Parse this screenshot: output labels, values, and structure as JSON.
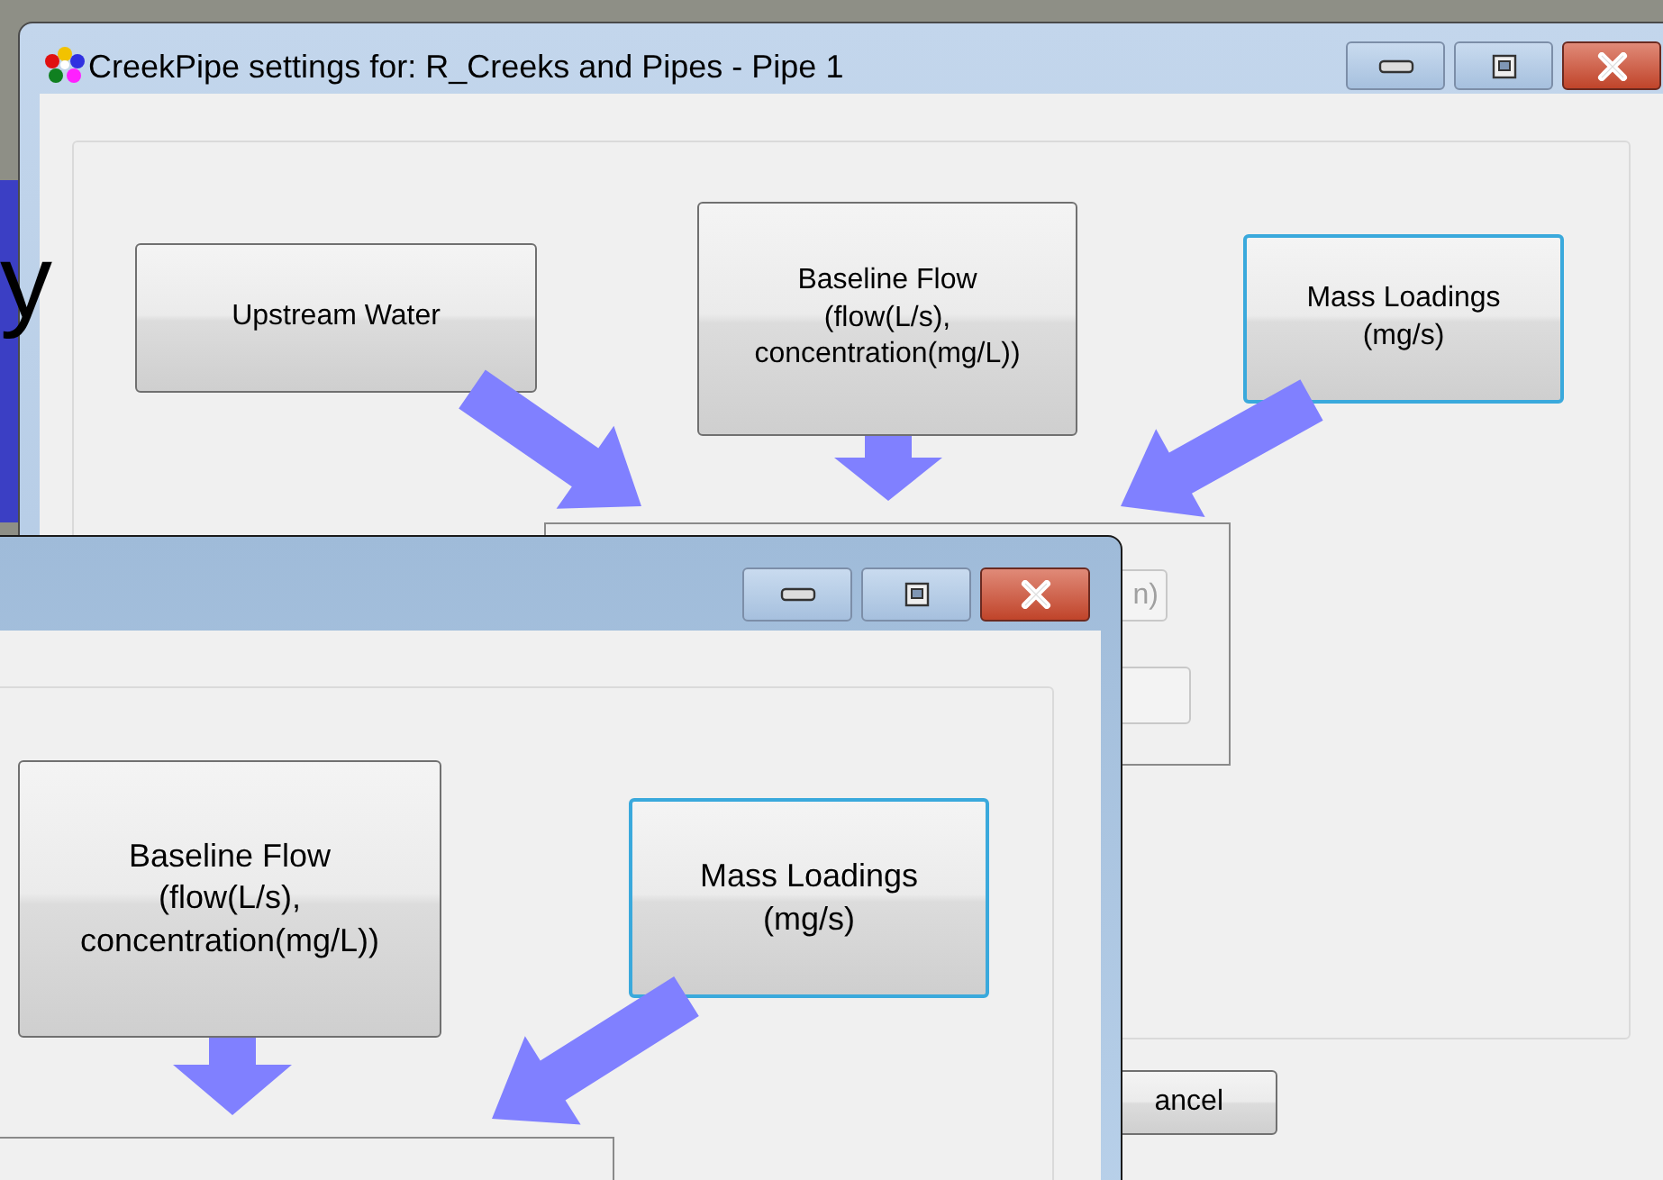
{
  "background_text": "y",
  "back_window": {
    "title": "CreekPipe settings for: R_Creeks and Pipes - Pipe 1",
    "nodes": [
      {
        "label": "Upstream Water",
        "focused": false
      },
      {
        "label": "Baseline Flow\n(flow(L/s),\nconcentration(mg/L))",
        "focused": false
      },
      {
        "label": "Mass Loadings\n(mg/s)",
        "focused": true
      }
    ],
    "partial_button": "n)",
    "cancel_button": "ancel"
  },
  "front_window": {
    "nodes": [
      {
        "label": "Baseline Flow\n(flow(L/s),\nconcentration(mg/L))",
        "focused": false
      },
      {
        "label": "Mass Loadings\n(mg/s)",
        "focused": true
      }
    ]
  }
}
